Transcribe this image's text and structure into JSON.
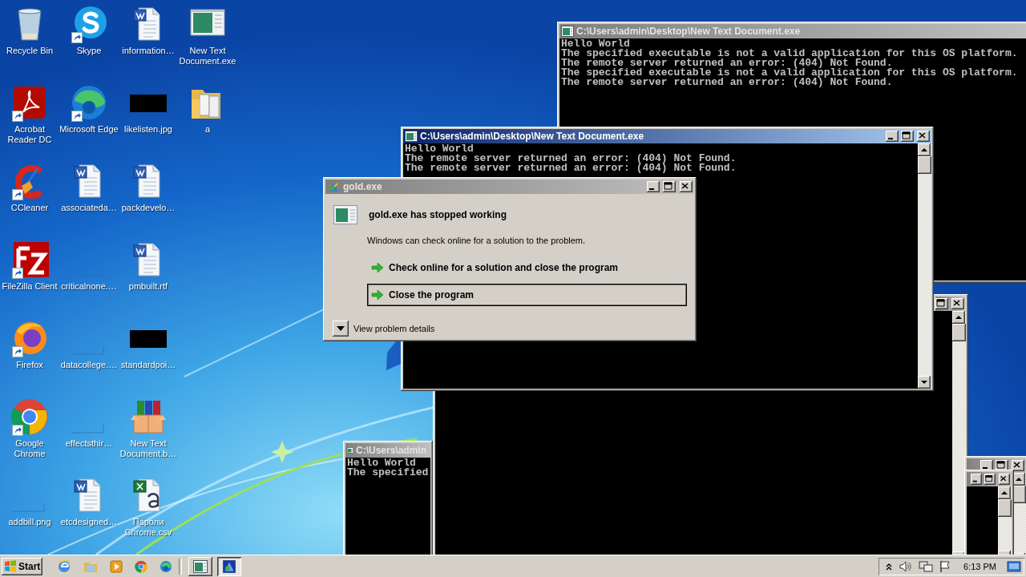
{
  "desktop_icons": [
    {
      "label": "Recycle Bin",
      "kind": "recycle-bin",
      "shortcut": false
    },
    {
      "label": "Acrobat Reader DC",
      "kind": "acrobat",
      "shortcut": true
    },
    {
      "label": "CCleaner",
      "kind": "ccleaner",
      "shortcut": true
    },
    {
      "label": "FileZilla Client",
      "kind": "filezilla",
      "shortcut": true
    },
    {
      "label": "Firefox",
      "kind": "firefox",
      "shortcut": true
    },
    {
      "label": "Google Chrome",
      "kind": "chrome",
      "shortcut": true
    },
    {
      "label": "addbill.png",
      "kind": "thumbnail",
      "shortcut": false
    },
    {
      "label": "Skype",
      "kind": "skype",
      "shortcut": true
    },
    {
      "label": "Microsoft Edge",
      "kind": "edge",
      "shortcut": true
    },
    {
      "label": "associateda…",
      "kind": "word",
      "shortcut": false
    },
    {
      "label": "criticalnone.…",
      "kind": "thumbnail",
      "shortcut": false
    },
    {
      "label": "datacollege.…",
      "kind": "thumbnail",
      "shortcut": false
    },
    {
      "label": "effectsthir…",
      "kind": "thumbnail",
      "shortcut": false
    },
    {
      "label": "etcdesigned…",
      "kind": "word",
      "shortcut": false
    },
    {
      "label": "information…",
      "kind": "word",
      "shortcut": false
    },
    {
      "label": "likelisten.jpg",
      "kind": "dark-image",
      "shortcut": false
    },
    {
      "label": "packdevelo…",
      "kind": "word",
      "shortcut": false
    },
    {
      "label": "pmbuilt.rtf",
      "kind": "word",
      "shortcut": false
    },
    {
      "label": "standardpoi…",
      "kind": "dark-image",
      "shortcut": false
    },
    {
      "label": "New Text Document.b…",
      "kind": "archive",
      "shortcut": false
    },
    {
      "label": "Пароли Chrome.csv",
      "kind": "spreadsheet",
      "shortcut": false
    },
    {
      "label": "New Text Document.exe",
      "kind": "program",
      "shortcut": false
    },
    {
      "label": "a",
      "kind": "folder",
      "shortcut": false
    }
  ],
  "windows": [
    {
      "title": "C:\\Users\\admin\\Desktop\\New Text Document.exe",
      "active": false,
      "lines": [
        "Hello World",
        "The specified executable is not a valid application for this OS platform.",
        "The remote server returned an error: (404) Not Found.",
        "The specified executable is not a valid application for this OS platform.",
        "The remote server returned an error: (404) Not Found."
      ]
    },
    {
      "title": "C:\\Users\\admin",
      "active": false,
      "lines": [
        "Hello World",
        "The specified"
      ]
    },
    {
      "active": false
    },
    {
      "title": "C:\\Users\\admin\\Desktop\\New Text Document.exe",
      "active": true,
      "lines": [
        "Hello World",
        "The remote server returned an error: (404) Not Found.",
        "The remote server returned an error: (404) Not Found."
      ]
    },
    {
      "active": false
    },
    {
      "active": false
    }
  ],
  "dialog": {
    "title": "gold.exe",
    "heading": "gold.exe has stopped working",
    "message": "Windows can check online for a solution to the problem.",
    "options": [
      {
        "label": "Check online for a solution and close the program",
        "selected": false
      },
      {
        "label": "Close the program",
        "selected": true
      }
    ],
    "details": "View problem details"
  },
  "taskbar": {
    "start": "Start",
    "tasks": [
      {
        "kind": "console",
        "selected": false
      },
      {
        "kind": "error-report",
        "selected": true
      }
    ],
    "clock": "6:13 PM"
  }
}
